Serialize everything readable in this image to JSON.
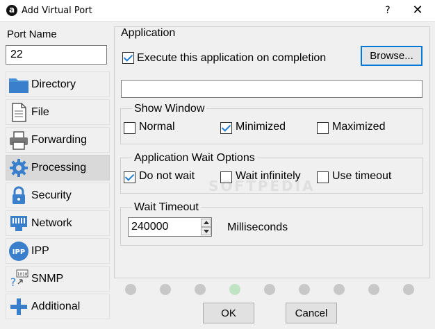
{
  "window": {
    "title": "Add Virtual Port",
    "help": "?",
    "close": "✕",
    "app_icon_glyph": "a"
  },
  "port": {
    "label": "Port Name",
    "value": "22"
  },
  "nav": {
    "items": [
      {
        "label": "Directory",
        "icon": "folder-icon"
      },
      {
        "label": "File",
        "icon": "file-icon"
      },
      {
        "label": "Forwarding",
        "icon": "printer-icon"
      },
      {
        "label": "Processing",
        "icon": "gear-icon",
        "active": true
      },
      {
        "label": "Security",
        "icon": "lock-icon"
      },
      {
        "label": "Network",
        "icon": "network-icon"
      },
      {
        "label": "IPP",
        "icon": "ipp-icon",
        "icon_text": "IPP"
      },
      {
        "label": "SNMP",
        "icon": "snmp-icon",
        "icon_text": "1010"
      },
      {
        "label": "Additional",
        "icon": "plus-icon"
      }
    ]
  },
  "application": {
    "title": "Application",
    "execute_label": "Execute this application on completion",
    "execute_checked": true,
    "browse_label": "Browse...",
    "path_value": ""
  },
  "show_window": {
    "title": "Show Window",
    "options": [
      {
        "label": "Normal",
        "checked": false
      },
      {
        "label": "Minimized",
        "checked": true
      },
      {
        "label": "Maximized",
        "checked": false
      }
    ]
  },
  "wait_options": {
    "title": "Application Wait Options",
    "options": [
      {
        "label": "Do not wait",
        "checked": true
      },
      {
        "label": "Wait infinitely",
        "checked": false
      },
      {
        "label": "Use timeout",
        "checked": false
      }
    ]
  },
  "wait_timeout": {
    "title": "Wait Timeout",
    "value": "240000",
    "unit": "Milliseconds"
  },
  "steps": {
    "count": 9,
    "active_index": 3
  },
  "buttons": {
    "ok": "OK",
    "cancel": "Cancel"
  },
  "watermark": "SOFTPEDIA",
  "colors": {
    "accent": "#0078d7",
    "folder": "#4a90d9",
    "active_step": "#bfe3c3"
  }
}
